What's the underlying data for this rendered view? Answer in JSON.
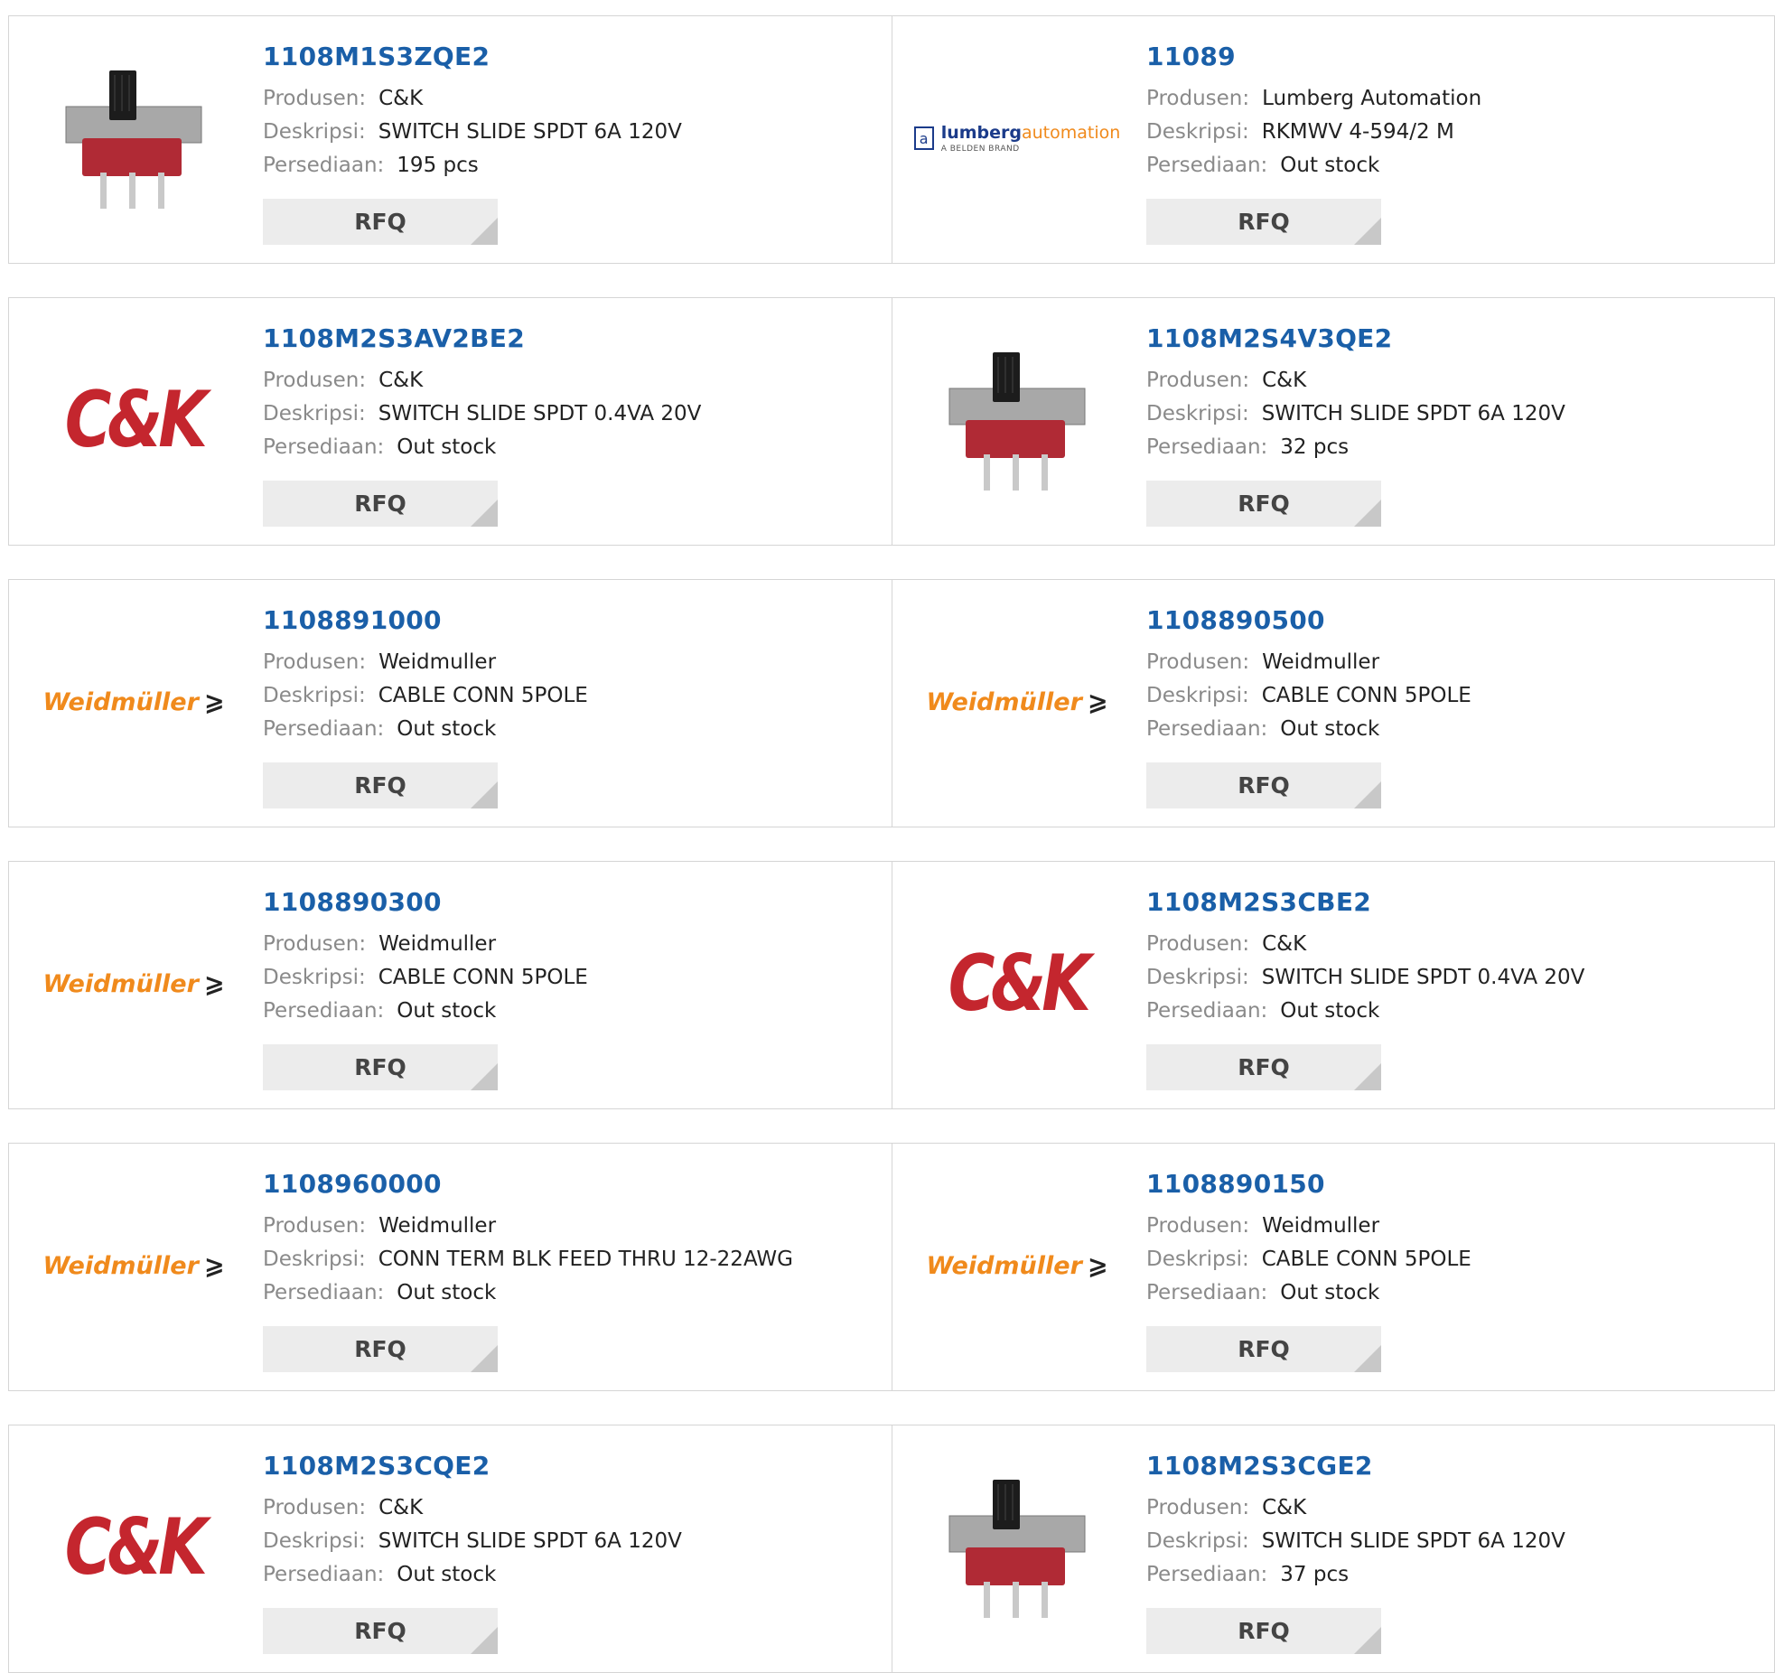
{
  "labels": {
    "manufacturer": "Produsen:",
    "description": "Deskripsi:",
    "stock": "Persediaan:",
    "rfq": "RFQ"
  },
  "colors": {
    "link": "#1a5fa8",
    "ck_red": "#c4262e",
    "weidmuller_orange": "#f08a1c",
    "button_bg": "#ececec"
  },
  "products": [
    {
      "part": "1108M1S3ZQE2",
      "manufacturer": "C&K",
      "description": "SWITCH SLIDE SPDT 6A 120V",
      "stock": "195 pcs",
      "image": "slide-switch-photo"
    },
    {
      "part": "11089",
      "manufacturer": "Lumberg Automation",
      "description": "RKMWV 4-594/2 M",
      "stock": "Out stock",
      "image": "lumberg-automation-logo",
      "logo_text": {
        "lumberg": "lumberg",
        "automation": "automation",
        "sub": "A BELDEN BRAND"
      }
    },
    {
      "part": "1108M2S3AV2BE2",
      "manufacturer": "C&K",
      "description": "SWITCH SLIDE SPDT 0.4VA 20V",
      "stock": "Out stock",
      "image": "ck-logo",
      "logo_text": "C&K"
    },
    {
      "part": "1108M2S4V3QE2",
      "manufacturer": "C&K",
      "description": "SWITCH SLIDE SPDT 6A 120V",
      "stock": "32 pcs",
      "image": "slide-switch-photo"
    },
    {
      "part": "1108891000",
      "manufacturer": "Weidmuller",
      "description": "CABLE CONN 5POLE",
      "stock": "Out stock",
      "image": "weidmuller-logo",
      "logo_text": "Weidmüller"
    },
    {
      "part": "1108890500",
      "manufacturer": "Weidmuller",
      "description": "CABLE CONN 5POLE",
      "stock": "Out stock",
      "image": "weidmuller-logo",
      "logo_text": "Weidmüller"
    },
    {
      "part": "1108890300",
      "manufacturer": "Weidmuller",
      "description": "CABLE CONN 5POLE",
      "stock": "Out stock",
      "image": "weidmuller-logo",
      "logo_text": "Weidmüller"
    },
    {
      "part": "1108M2S3CBE2",
      "manufacturer": "C&K",
      "description": "SWITCH SLIDE SPDT 0.4VA 20V",
      "stock": "Out stock",
      "image": "ck-logo",
      "logo_text": "C&K"
    },
    {
      "part": "1108960000",
      "manufacturer": "Weidmuller",
      "description": "CONN TERM BLK FEED THRU 12-22AWG",
      "stock": "Out stock",
      "image": "weidmuller-logo",
      "logo_text": "Weidmüller"
    },
    {
      "part": "1108890150",
      "manufacturer": "Weidmuller",
      "description": "CABLE CONN 5POLE",
      "stock": "Out stock",
      "image": "weidmuller-logo",
      "logo_text": "Weidmüller"
    },
    {
      "part": "1108M2S3CQE2",
      "manufacturer": "C&K",
      "description": "SWITCH SLIDE SPDT 6A 120V",
      "stock": "Out stock",
      "image": "ck-logo",
      "logo_text": "C&K"
    },
    {
      "part": "1108M2S3CGE2",
      "manufacturer": "C&K",
      "description": "SWITCH SLIDE SPDT 6A 120V",
      "stock": "37 pcs",
      "image": "slide-switch-photo"
    }
  ]
}
